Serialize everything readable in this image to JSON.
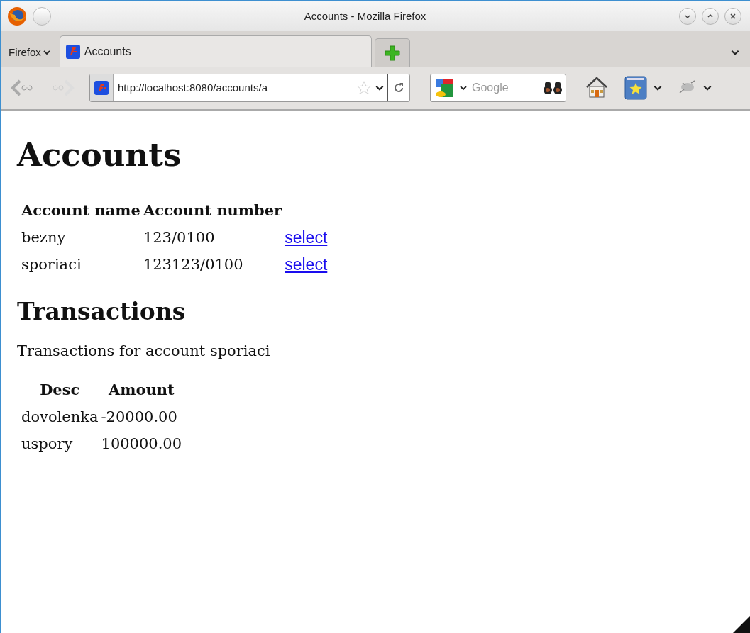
{
  "window": {
    "title": "Accounts - Mozilla Firefox"
  },
  "menu_button": {
    "label": "Firefox"
  },
  "tabs": [
    {
      "label": "Accounts",
      "selected": true
    }
  ],
  "address_bar": {
    "url": "http://localhost:8080/accounts/a"
  },
  "search": {
    "placeholder": "Google"
  },
  "page": {
    "heading": "Accounts",
    "accounts_table": {
      "columns": [
        "Account name",
        "Account number"
      ],
      "rows": [
        {
          "name": "bezny",
          "number": "123/0100",
          "link": "select"
        },
        {
          "name": "sporiaci",
          "number": "123123/0100",
          "link": "select"
        }
      ]
    },
    "subheading": "Transactions",
    "caption": "Transactions for account sporiaci",
    "transactions_table": {
      "columns": [
        "Desc",
        "Amount"
      ],
      "rows": [
        {
          "desc": "dovolenka",
          "amount": "-20000.00"
        },
        {
          "desc": "uspory",
          "amount": "100000.00"
        }
      ]
    }
  }
}
